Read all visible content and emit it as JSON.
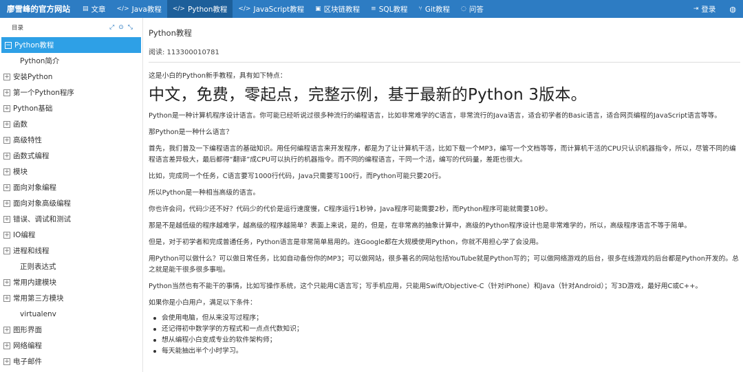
{
  "brand": "廖雪峰的官方网站",
  "nav": {
    "items": [
      {
        "icon": "book-icon",
        "glyph": "▤",
        "label": "文章"
      },
      {
        "icon": "code-icon",
        "glyph": "</>",
        "label": "Java教程"
      },
      {
        "icon": "code-icon",
        "glyph": "</>",
        "label": "Python教程",
        "active": true
      },
      {
        "icon": "code-icon",
        "glyph": "</>",
        "label": "JavaScript教程"
      },
      {
        "icon": "blockchain-icon",
        "glyph": "▣",
        "label": "区块链教程"
      },
      {
        "icon": "database-icon",
        "glyph": "≡",
        "label": "SQL教程"
      },
      {
        "icon": "git-icon",
        "glyph": "⑂",
        "label": "Git教程"
      },
      {
        "icon": "chat-icon",
        "glyph": "◌",
        "label": "问答"
      }
    ],
    "login": "登录",
    "login_icon": "login-icon",
    "globe_icon": "globe-icon"
  },
  "sidebar": {
    "title": "目录",
    "tools": [
      "expand-icon",
      "locate-icon",
      "collapse-icon"
    ],
    "items": [
      {
        "label": "Python教程",
        "toggle": "−",
        "active": true
      },
      {
        "label": "Python简介",
        "leaf": true
      },
      {
        "label": "安装Python",
        "toggle": "+"
      },
      {
        "label": "第一个Python程序",
        "toggle": "+"
      },
      {
        "label": "Python基础",
        "toggle": "+"
      },
      {
        "label": "函数",
        "toggle": "+"
      },
      {
        "label": "高级特性",
        "toggle": "+"
      },
      {
        "label": "函数式编程",
        "toggle": "+"
      },
      {
        "label": "模块",
        "toggle": "+"
      },
      {
        "label": "面向对象编程",
        "toggle": "+"
      },
      {
        "label": "面向对象高级编程",
        "toggle": "+"
      },
      {
        "label": "错误、调试和测试",
        "toggle": "+"
      },
      {
        "label": "IO编程",
        "toggle": "+"
      },
      {
        "label": "进程和线程",
        "toggle": "+"
      },
      {
        "label": "正则表达式",
        "leaf": true
      },
      {
        "label": "常用内建模块",
        "toggle": "+"
      },
      {
        "label": "常用第三方模块",
        "toggle": "+"
      },
      {
        "label": "virtualenv",
        "leaf": true
      },
      {
        "label": "图形界面",
        "toggle": "+"
      },
      {
        "label": "网络编程",
        "toggle": "+"
      },
      {
        "label": "电子邮件",
        "toggle": "+"
      }
    ]
  },
  "main": {
    "title": "Python教程",
    "reads": "阅读: 113300010781",
    "intro": "这是小白的Python新手教程，具有如下特点：",
    "headline": "中文，免费，零起点，完整示例，基于最新的Python 3版本。",
    "paragraphs": [
      "Python是一种计算机程序设计语言。你可能已经听说过很多种流行的编程语言，比如非常难学的C语言，非常流行的Java语言，适合初学者的Basic语言，适合网页编程的JavaScript语言等等。",
      "那Python是一种什么语言？",
      "首先，我们普及一下编程语言的基础知识。用任何编程语言来开发程序，都是为了让计算机干活，比如下载一个MP3，编写一个文档等等，而计算机干活的CPU只认识机器指令，所以，尽管不同的编程语言差异极大，最后都得“翻译”成CPU可以执行的机器指令。而不同的编程语言，干同一个活，编写的代码量，差距也很大。",
      "比如，完成同一个任务，C语言要写1000行代码，Java只需要写100行，而Python可能只要20行。",
      "所以Python是一种相当高级的语言。",
      "你也许会问，代码少还不好？代码少的代价是运行速度慢，C程序运行1秒钟，Java程序可能需要2秒，而Python程序可能就需要10秒。",
      "那是不是越低级的程序越难学，越高级的程序越简单？表面上来说，是的，但是，在非常高的抽象计算中，高级的Python程序设计也是非常难学的，所以，高级程序语言不等于简单。",
      "但是，对于初学者和完成普通任务，Python语言是非常简单易用的。连Google都在大规模使用Python，你就不用担心学了会没用。",
      "用Python可以做什么？可以做日常任务，比如自动备份你的MP3；可以做网站，很多著名的网站包括YouTube就是Python写的；可以做网络游戏的后台，很多在线游戏的后台都是Python开发的。总之就是能干很多很多事啦。",
      "Python当然也有不能干的事情，比如写操作系统，这个只能用C语言写；写手机应用，只能用Swift/Objective-C（针对iPhone）和Java（针对Android）；写3D游戏，最好用C或C++。",
      "如果你是小白用户，满足以下条件："
    ],
    "conditions": [
      "会使用电脑，但从来没写过程序；",
      "还记得初中数学学的方程式和一点点代数知识；",
      "想从编程小白变成专业的软件架构师；",
      "每天能抽出半个小时学习。"
    ]
  }
}
